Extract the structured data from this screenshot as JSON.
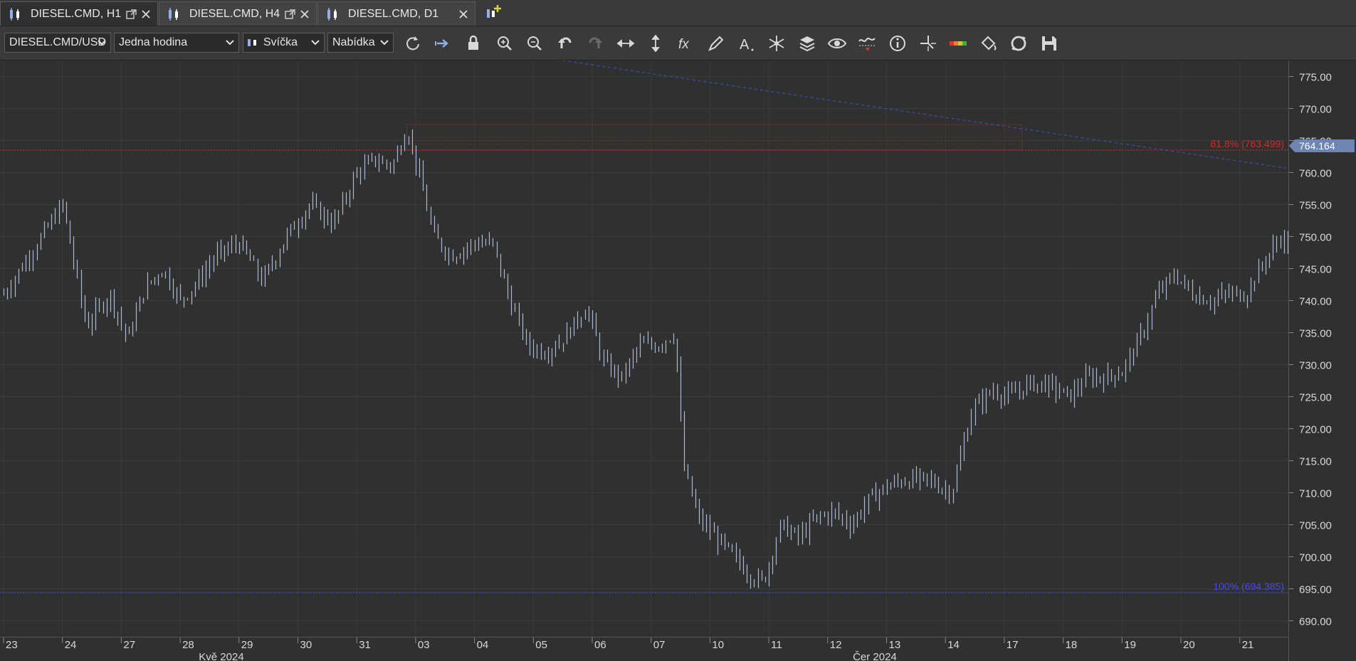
{
  "tabs": [
    {
      "label": "DIESEL.CMD, H1",
      "active": true
    },
    {
      "label": "DIESEL.CMD, H4",
      "active": false
    },
    {
      "label": "DIESEL.CMD, D1",
      "active": false
    }
  ],
  "toolbar": {
    "instrument": "DIESEL.CMD/USD",
    "period": "Jedna hodina",
    "chart_type": "Svíčka",
    "offer_side": "Nabídka",
    "icons": [
      "refresh-icon",
      "auto-scroll-icon",
      "lock-icon",
      "zoom-in-icon",
      "zoom-out-icon",
      "undo-icon",
      "redo-icon",
      "horizontal-resize-icon",
      "vertical-resize-icon",
      "indicators-fx-icon",
      "pencil-icon",
      "text-tool-icon",
      "pattern-icon",
      "layers-icon",
      "eye-icon",
      "signal-icon",
      "info-icon",
      "crosshair-icon",
      "color-bar-icon",
      "paint-bucket-icon",
      "sync-icon",
      "save-icon"
    ]
  },
  "price_axis": {
    "ticks": [
      "775.00",
      "770.00",
      "765.00",
      "760.00",
      "755.00",
      "750.00",
      "745.00",
      "740.00",
      "735.00",
      "730.00",
      "725.00",
      "720.00",
      "715.00",
      "710.00",
      "705.00",
      "700.00",
      "695.00",
      "690.00"
    ],
    "current_price": "764.164"
  },
  "time_axis": {
    "day_labels": [
      "23",
      "24",
      "27",
      "28",
      "29",
      "30",
      "31",
      "03",
      "04",
      "05",
      "06",
      "07",
      "10",
      "11",
      "12",
      "13",
      "14",
      "17",
      "18",
      "19",
      "20",
      "21"
    ],
    "month_labels": [
      "Kvě 2024",
      "Čer 2024"
    ]
  },
  "fib_levels": {
    "level_618": "61.8% (763.499)",
    "level_100": "100% (694.385)"
  },
  "colors": {
    "background": "#303030",
    "bars": "#aab8d0",
    "fib_618": "#d12a2a",
    "fib_100": "#4a4ae0",
    "arrow": "#ff1a1a",
    "price_label": "#6f86b4"
  },
  "chart_data": {
    "type": "bar",
    "title": "DIESEL.CMD/USD H1",
    "ylim": [
      687.5,
      777.5
    ],
    "price_path": [
      [
        23,
        741
      ],
      [
        23.5,
        748
      ],
      [
        24,
        755
      ],
      [
        24.4,
        736
      ],
      [
        24.8,
        741
      ],
      [
        25.1,
        734
      ],
      [
        25.4,
        742
      ],
      [
        25.7,
        745
      ],
      [
        26,
        740
      ],
      [
        26.3,
        743
      ],
      [
        26.6,
        747
      ],
      [
        27,
        749
      ],
      [
        27.4,
        743
      ],
      [
        27.8,
        750
      ],
      [
        28.2,
        755
      ],
      [
        28.6,
        752
      ],
      [
        29,
        760
      ],
      [
        29.3,
        762
      ],
      [
        29.6,
        761
      ],
      [
        29.85,
        767
      ],
      [
        30.1,
        758
      ],
      [
        30.3,
        750
      ],
      [
        30.6,
        747
      ],
      [
        31,
        749
      ],
      [
        31.3,
        749
      ],
      [
        31.6,
        740
      ],
      [
        31.9,
        733
      ],
      [
        32.2,
        732
      ],
      [
        32.5,
        734
      ],
      [
        32.9,
        739
      ],
      [
        33.2,
        730
      ],
      [
        33.5,
        728
      ],
      [
        33.8,
        733
      ],
      [
        34.1,
        733
      ],
      [
        34.4,
        735
      ],
      [
        34.55,
        714
      ],
      [
        34.8,
        706
      ],
      [
        35.1,
        703
      ],
      [
        35.4,
        700
      ],
      [
        35.7,
        697
      ],
      [
        35.9,
        696
      ],
      [
        36.2,
        705
      ],
      [
        36.5,
        703
      ],
      [
        36.8,
        706
      ],
      [
        37.1,
        707
      ],
      [
        37.4,
        705
      ],
      [
        37.7,
        709
      ],
      [
        38,
        711
      ],
      [
        38.3,
        712
      ],
      [
        38.7,
        712
      ],
      [
        39.1,
        710
      ],
      [
        39.45,
        723
      ],
      [
        39.8,
        726
      ],
      [
        40.1,
        725
      ],
      [
        40.4,
        727
      ],
      [
        40.7,
        727
      ],
      [
        41.1,
        725
      ],
      [
        41.4,
        728
      ],
      [
        41.7,
        728
      ],
      [
        42,
        729
      ],
      [
        42.3,
        734
      ],
      [
        42.6,
        741
      ],
      [
        42.9,
        744
      ],
      [
        43.2,
        741
      ],
      [
        43.5,
        740
      ],
      [
        43.8,
        741
      ],
      [
        44.1,
        741
      ],
      [
        44.4,
        746
      ],
      [
        44.7,
        750
      ],
      [
        45,
        747
      ],
      [
        45.3,
        750
      ],
      [
        45.6,
        752
      ],
      [
        45.9,
        757
      ],
      [
        46.2,
        759
      ],
      [
        46.5,
        751
      ],
      [
        46.8,
        749
      ],
      [
        47.1,
        749
      ],
      [
        47.4,
        748
      ],
      [
        47.7,
        749
      ],
      [
        48,
        757
      ],
      [
        48.3,
        764
      ],
      [
        48.6,
        765
      ]
    ]
  }
}
